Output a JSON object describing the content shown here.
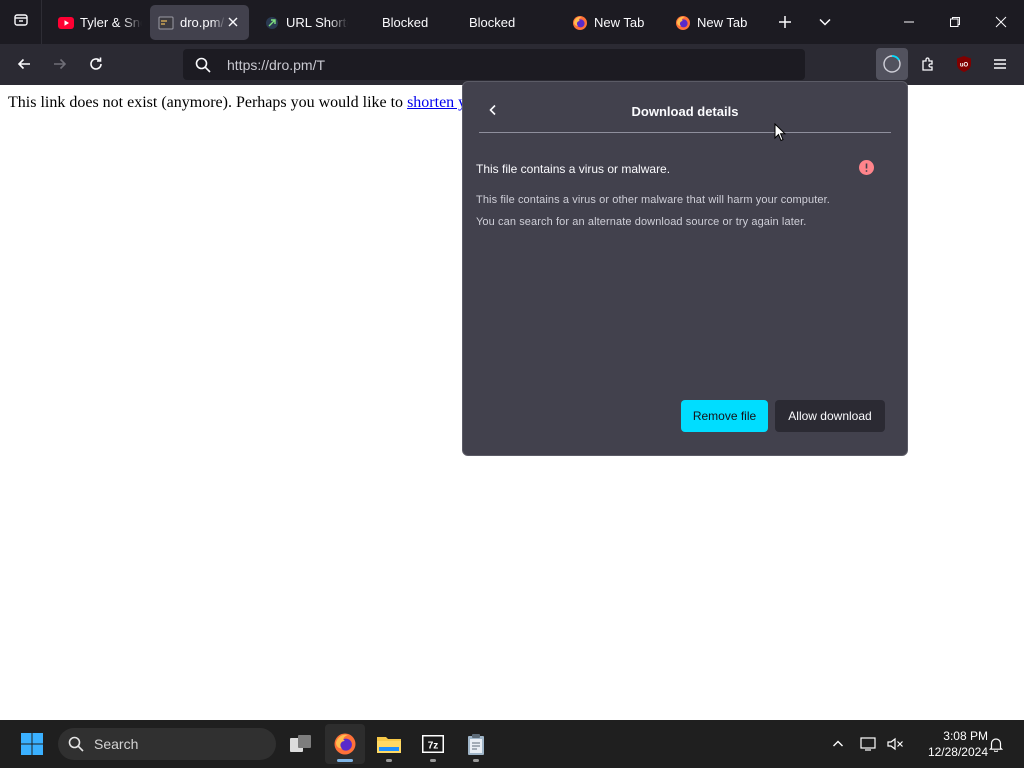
{
  "browser": {
    "tabs": [
      {
        "title": "Tyler & Sno",
        "icon": "youtube-icon",
        "active": false
      },
      {
        "title": "dro.pm/",
        "icon": "site-favicon-icon",
        "active": true
      },
      {
        "title": "URL Shorte",
        "icon": "url-shortener-favicon-icon",
        "active": false
      },
      {
        "title": "Blocked",
        "icon": "",
        "active": false
      },
      {
        "title": "Blocked",
        "icon": "",
        "active": false
      },
      {
        "title": "New Tab",
        "icon": "firefox-icon",
        "active": false
      },
      {
        "title": "New Tab",
        "icon": "firefox-icon",
        "active": false
      }
    ],
    "url": "https://dro.pm/T"
  },
  "page": {
    "text": "This link does not exist (anymore). Perhaps you would like to ",
    "link_text": "shorten y"
  },
  "download_panel": {
    "title": "Download details",
    "warning_title": "This file contains a virus or malware.",
    "warning_line1": "This file contains a virus or other malware that will harm your computer.",
    "warning_line2": "You can search for an alternate download source or try again later.",
    "remove_label": "Remove file",
    "allow_label": "Allow download"
  },
  "taskbar": {
    "search_label": "Search",
    "time": "3:08 PM",
    "date": "12/28/2024"
  },
  "colors": {
    "accent": "#00ddff",
    "warning": "#ff848b",
    "panel_bg": "#42414d",
    "toolbar_bg": "#2b2a33",
    "tabstrip_bg": "#1c1b22"
  }
}
